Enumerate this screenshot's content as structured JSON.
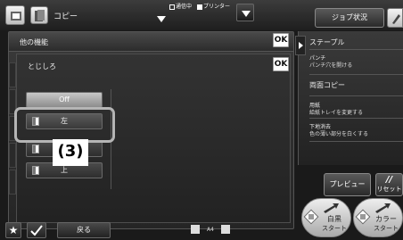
{
  "header": {
    "mode_label": "コピー",
    "status_items": [
      "通信中",
      "プリンター"
    ],
    "job_status_label": "ジョブ状況"
  },
  "panel": {
    "title": "他の機能",
    "sub_title": "とじしろ",
    "ok_label": "OK",
    "options": {
      "off": "Off",
      "left": "左",
      "right": "右",
      "top": "上"
    }
  },
  "callout": "(3)",
  "bottom": {
    "back_label": "戻る",
    "paper_size": "A4"
  },
  "right_panel": {
    "items": [
      {
        "title": "ステープル",
        "sub": ""
      },
      {
        "title": "パンチ",
        "sub": "パンチ穴を開ける"
      },
      {
        "title": "両面コピー",
        "sub": ""
      },
      {
        "title": "用紙",
        "sub": "給紙トレイを変更する"
      },
      {
        "title": "下地消去",
        "sub": "色の薄い部分を白くする"
      }
    ],
    "preview_label": "プレビュー",
    "reset_label": "リセット",
    "bw_start": {
      "line1": "白黒",
      "line2": "スタート"
    },
    "color_start": {
      "line1": "カラー",
      "line2": "スタート"
    }
  }
}
